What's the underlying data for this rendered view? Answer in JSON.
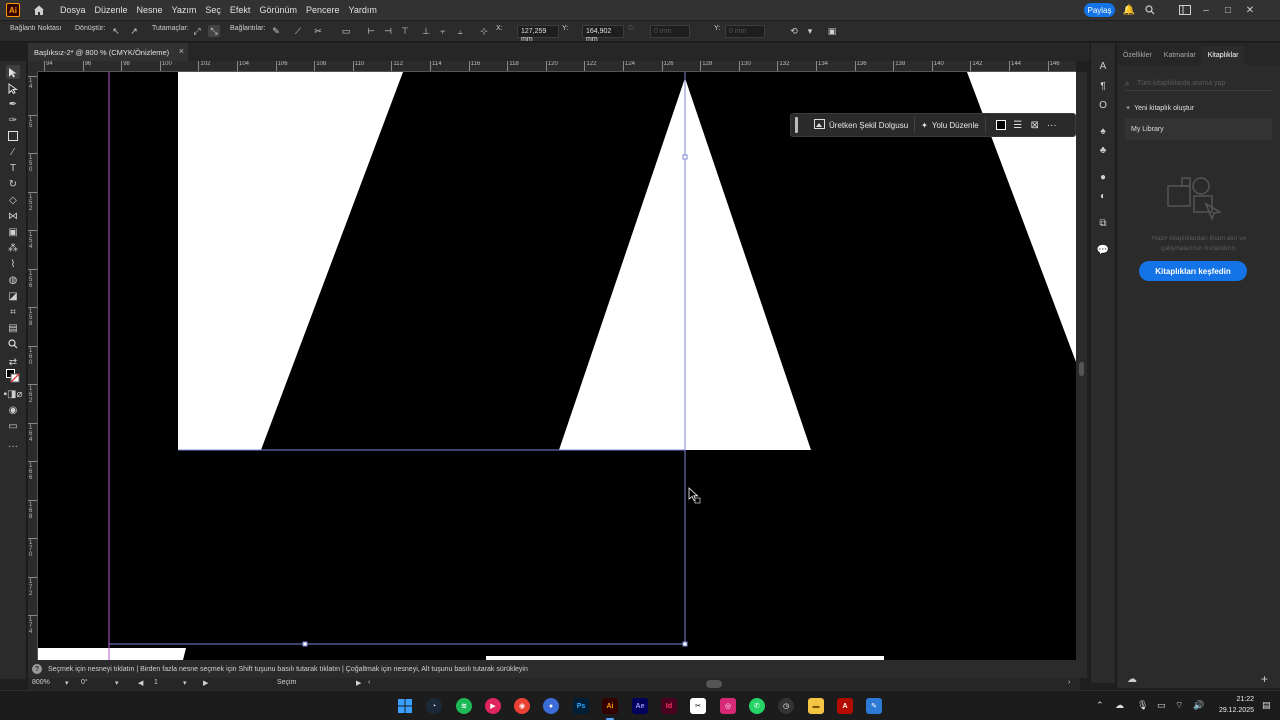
{
  "app": {
    "logo": "Ai"
  },
  "menu": [
    "Dosya",
    "Düzenle",
    "Nesne",
    "Yazım",
    "Seç",
    "Efekt",
    "Görünüm",
    "Pencere",
    "Yardım"
  ],
  "share_label": "Paylaş",
  "control": {
    "anchor_label": "Bağlantı Noktası",
    "convert_label": "Dönüştür:",
    "handles_label": "Tutamaçlar:",
    "anchors_label": "Bağlantılar:",
    "x_label": "X:",
    "x_value": "127,259 mm",
    "y_label": "Y:",
    "y_value": "164,902 mm",
    "w_label": "G:",
    "w_value": "0 mm",
    "h_label": "Y:",
    "h_value": "0 mm"
  },
  "doc_tab": {
    "title": "Başlıksız-2* @ 800 % (CMYK/Önizleme)",
    "close": "×"
  },
  "ruler_h": [
    "94",
    "96",
    "98",
    "100",
    "102",
    "104",
    "106",
    "108",
    "110",
    "112",
    "114",
    "116",
    "118",
    "120",
    "122",
    "124",
    "126",
    "128",
    "130",
    "132",
    "134",
    "136",
    "138",
    "140",
    "142",
    "144",
    "146"
  ],
  "ruler_v": [
    "1\n4",
    "1\n5",
    "1\n5\n0",
    "1\n5\n2",
    "1\n5\n4",
    "1\n5\n6",
    "1\n5\n8",
    "1\n6\n0",
    "1\n6\n2",
    "1\n6\n4",
    "1\n6\n6",
    "1\n6\n8",
    "1\n7\n0",
    "1\n7\n2",
    "1\n7\n4"
  ],
  "context_bar": {
    "fill_label": "Üretken Şekil Dolgusu",
    "path_label": "Yolu Düzenle"
  },
  "panel": {
    "tabs": [
      "Özellikler",
      "Katmanlar",
      "Kitaplıklar"
    ],
    "active_tab": "Kitaplıklar",
    "search_placeholder": "Tüm kitaplıklarda arama yap",
    "new_library": "Yeni kitaplık oluştur",
    "my_library": "My Library",
    "info_text": "Hazır kitaplıklardan ilham alın ve çalışmalarınızı hızlandırın.",
    "explore_button": "Kitaplıkları keşfedin"
  },
  "hint": "Seçmek için nesneyi tıklatın | Birden fazla nesne seçmek için Shift tuşunu basılı tutarak tıklatın | Çoğaltmak için nesneyi, Alt tuşunu basılı tutarak sürükleyin",
  "status": {
    "zoom": "800%",
    "rotate": "0°",
    "artboard": "1",
    "tool": "Seçim"
  },
  "clock": {
    "time": "21:22",
    "date": "29.12.2025"
  },
  "taskbar_icons": [
    "windows-start-icon",
    "steam-icon",
    "spotify-icon",
    "media-player-icon",
    "chrome-icon",
    "app-icon",
    "photoshop-icon",
    "illustrator-icon",
    "after-effects-icon",
    "indesign-icon",
    "capcut-icon",
    "instagram-icon",
    "whatsapp-icon",
    "file-explorer-icon",
    "acrobat-icon",
    "paint-icon"
  ],
  "taskbar_labels": {
    "photoshop": "Ps",
    "illustrator": "Ai",
    "after_effects": "Ae",
    "indesign": "Id"
  }
}
